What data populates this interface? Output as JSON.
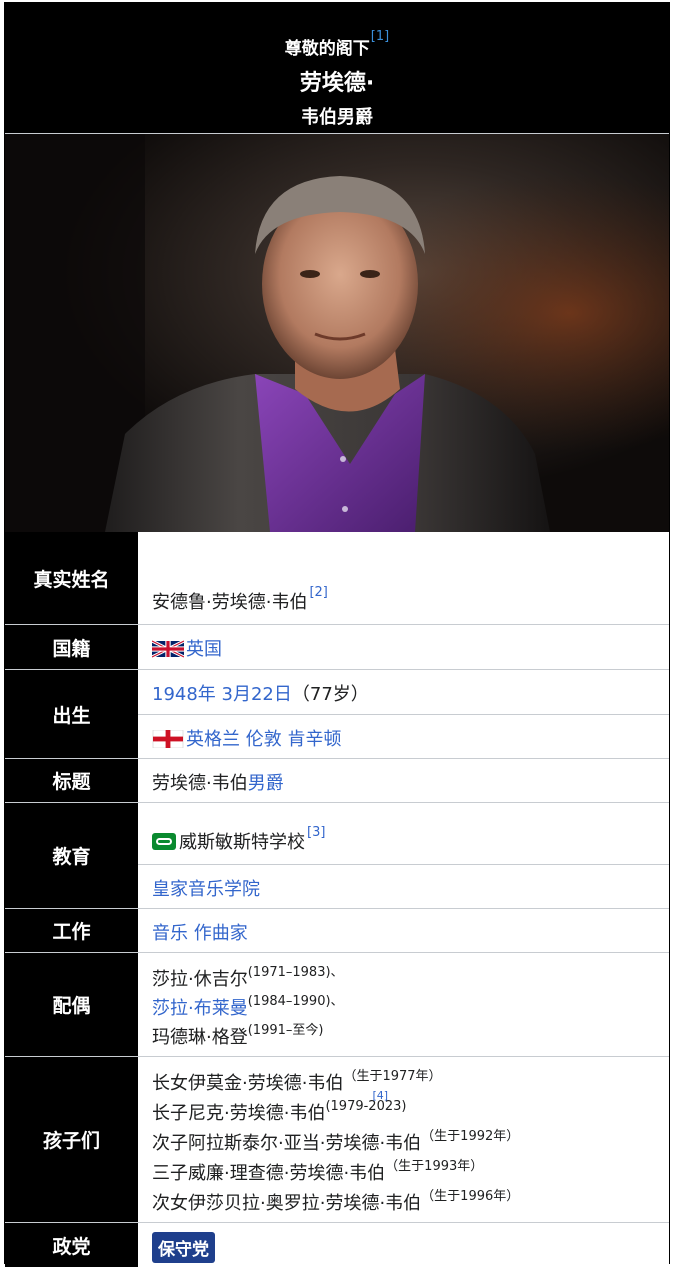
{
  "header": {
    "honorific": "尊敬的阁下",
    "honorific_ref": "[1]",
    "name_line1": "劳埃德·",
    "name_line2": "韦伯男爵"
  },
  "photo": {
    "alt": "portrait-photo"
  },
  "rows": {
    "real_name": {
      "label": "真实姓名",
      "value": "安德鲁·劳埃德·韦伯",
      "ref": "[2]"
    },
    "nationality": {
      "label": "国籍",
      "flag": "uk-flag-icon",
      "value": "英国"
    },
    "born": {
      "label": "出生",
      "date": "1948年 3月22日",
      "age": "（77岁）",
      "flag": "england-flag-icon",
      "place1": "英格兰",
      "place2": "伦敦",
      "place3": "肯辛顿"
    },
    "title": {
      "label": "标题",
      "prefix": "劳埃德·韦伯",
      "link": "男爵"
    },
    "education": {
      "label": "教育",
      "school1": "威斯敏斯特学校",
      "school1_ref": "[3]",
      "school2": "皇家音乐学院"
    },
    "work": {
      "label": "工作",
      "item1": "音乐",
      "item2": "作曲家"
    },
    "spouse": {
      "label": "配偶",
      "s1_name": "莎拉·休吉尔",
      "s1_years": "(1971–1983)、",
      "s2_name": "莎拉·布莱曼",
      "s2_years": "(1984–1990)、",
      "s3_name": "玛德琳·格登",
      "s3_years": "(1991–至今)"
    },
    "children": {
      "label": "孩子们",
      "c1_name": "长女伊莫金·劳埃德·韦伯",
      "c1_years": "（生于1977年）",
      "c2_name": "长子尼克·劳埃德·韦伯",
      "c2_years": "(1979-2023)",
      "c2_ref": "[4]",
      "c3_name": "次子阿拉斯泰尔·亚当·劳埃德·韦伯",
      "c3_years": "（生于1992年）",
      "c4_name": "三子威廉·理查德·劳埃德·韦伯",
      "c4_years": "（生于1993年）",
      "c5_name": "次女伊莎贝拉·奥罗拉·劳埃德·韦伯",
      "c5_years": "（生于1996年）"
    },
    "party": {
      "label": "政党",
      "value": "保守党"
    }
  },
  "colors": {
    "link": "#3366cc",
    "party": "#1f3f8c",
    "background": "#000000"
  }
}
